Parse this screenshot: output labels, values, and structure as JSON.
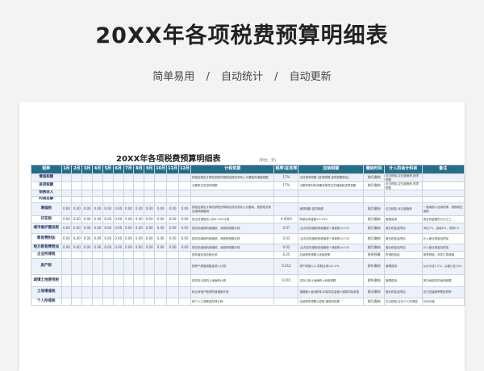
{
  "hero": {
    "title": "20XX年各项税费预算明细表",
    "tags": [
      "简单易用",
      "自动统计",
      "自动更新"
    ],
    "separator": "/"
  },
  "sheet": {
    "title": "20XX年各项税费预算明细表",
    "unit_note": "（单位：元）",
    "header_color": "#266d8a",
    "columns": [
      "税种",
      "1月",
      "2月",
      "3月",
      "4月",
      "5月",
      "6月",
      "7月",
      "8月",
      "9月",
      "10月",
      "11月",
      "12月",
      "计税依据",
      "税率\\征收率",
      "应纳税额",
      "缴纳时间",
      "计入的会计科目",
      "备注"
    ],
    "rows": [
      {
        "name": "增值税额",
        "months": [
          "",
          "",
          "",
          "",
          "",
          "",
          "",
          "",
          "",
          "",
          "",
          ""
        ],
        "basis": "按相应规定计算的销售货物和应税劳务收入为基础的增值税额",
        "rate": "17%",
        "tax": "当月销项税额-(进项税额-进项税额转出)",
        "time": "按月缴纳",
        "account": "应交税费-应交增值税-销项税额",
        "note": ""
      },
      {
        "name": "进项税额",
        "months": [
          "",
          "",
          "",
          "",
          "",
          "",
          "",
          "",
          "",
          "",
          "",
          ""
        ],
        "basis": "当期发生的进项税额",
        "rate": "17%",
        "tax": "当期采购材料或服务等发生的增值税进项税额",
        "time": "按月缴纳",
        "account": "应交税费-应交增值税-进项税额",
        "note": ""
      },
      {
        "name": "销售收入",
        "months": [
          "",
          "",
          "",
          "",
          "",
          "",
          "",
          "",
          "",
          "",
          "",
          ""
        ],
        "basis": "",
        "rate": "",
        "tax": "",
        "time": "",
        "account": "",
        "note": ""
      },
      {
        "name": "利润总额",
        "months": [
          "",
          "",
          "",
          "",
          "",
          "",
          "",
          "",
          "",
          "",
          "",
          ""
        ],
        "basis": "",
        "rate": "",
        "tax": "",
        "time": "",
        "account": "",
        "note": ""
      },
      {
        "name": "增值税",
        "months": [
          "0.00",
          "0.00",
          "0.00",
          "0.00",
          "0.00",
          "0.00",
          "0.00",
          "0.00",
          "0.00",
          "0.00",
          "0.00",
          "0.00"
        ],
        "basis": "按相应规定计算的销售货物和应税劳务收入为基础，按照相关规定缴纳增值税",
        "rate": "",
        "tax": "销项税额-进项税额",
        "time": "按月缴纳",
        "account": "应交税费-未交增值税",
        "note": "一般纳税人适用税率，按照规定缴纳"
      },
      {
        "name": "印花税",
        "months": [
          "0.00",
          "0.00",
          "0.00",
          "0.00",
          "0.00",
          "0.00",
          "0.00",
          "0.00",
          "0.00",
          "0.00",
          "0.00",
          "0.00"
        ],
        "basis": "按当月销售收入的0.03%计税",
        "rate": "0.0003",
        "tax": "购销合同金额×0.03%",
        "time": "按月缴纳",
        "account": "管理费用",
        "note": "按合同金额的万分之三"
      },
      {
        "name": "城市维护建设税",
        "months": [
          "0.00",
          "0.00",
          "0.00",
          "0.00",
          "0.00",
          "0.00",
          "0.00",
          "0.00",
          "0.00",
          "0.00",
          "0.00",
          "0.00"
        ],
        "basis": "按实际缴纳的增值税、消费税税额计税",
        "rate": "0.07",
        "tax": "(当月实际缴纳的增值税+消费税)×0.07",
        "time": "按月缴纳",
        "account": "营业税金及附加",
        "note": "市区7%，县城5%，其他1%"
      },
      {
        "name": "教育费附加",
        "months": [
          "0.00",
          "0.00",
          "0.00",
          "0.00",
          "0.00",
          "0.00",
          "0.00",
          "0.00",
          "0.00",
          "0.00",
          "0.00",
          "0.00"
        ],
        "basis": "按实际缴纳的增值税、消费税税额计税",
        "rate": "0.03",
        "tax": "(当月实际缴纳的增值税+消费税)×0.03",
        "time": "按月缴纳",
        "account": "营业税金及附加",
        "note": "计入营业税金及附加"
      },
      {
        "name": "地方教育费附加",
        "months": [
          "0.00",
          "0.00",
          "0.00",
          "0.00",
          "0.00",
          "0.00",
          "0.00",
          "0.00",
          "0.00",
          "0.00",
          "0.00",
          "0.00"
        ],
        "basis": "按实际缴纳的增值税、消费税税额计税",
        "rate": "0.02",
        "tax": "(当月实际缴纳的增值税+消费税)×0.02",
        "time": "按月缴纳",
        "account": "营业税金及附加",
        "note": "计入营业税金及附加"
      },
      {
        "name": "企业所得税",
        "months": [
          "",
          "",
          "",
          "",
          "",
          "",
          "",
          "",
          "",
          "",
          "",
          ""
        ],
        "basis": "按年度利润总额计税",
        "rate": "0.25",
        "tax": "应纳税所得额×适用税率",
        "time": "按季预缴",
        "account": "所得税费用",
        "note": "按季预缴，年终汇算清缴"
      },
      {
        "name": "房产税",
        "months": [
          "",
          "",
          "",
          "",
          "",
          "",
          "",
          "",
          "",
          "",
          "",
          ""
        ],
        "basis": "按房产原值或租金收入计税",
        "rate": "0.012",
        "tax": "房产原值×(1-扣除比例)×1.2%",
        "time": "按年缴纳",
        "account": "管理费用",
        "note": "从价计征1.2%，从租计征12%"
      },
      {
        "name": "城镇土地使用税",
        "months": [
          "",
          "",
          "",
          "",
          "",
          "",
          "",
          "",
          "",
          "",
          "",
          ""
        ],
        "basis": "按实际占用的土地面积计税",
        "rate": "0.015",
        "tax": "实际占用土地面积×适用税额",
        "time": "按年缴纳",
        "account": "管理费用",
        "note": "按当地规定的适用税额"
      },
      {
        "name": "土地增值税",
        "months": [
          "",
          "",
          "",
          "",
          "",
          "",
          "",
          "",
          "",
          "",
          "",
          ""
        ],
        "basis": "转让房地产取得的增值额计税",
        "rate": "",
        "tax": "增值额×适用税率-扣除项目金额×速算扣除系数",
        "time": "按次缴纳",
        "account": "营业税金及附加",
        "note": "实行四级超率累进税率"
      },
      {
        "name": "个人所得税",
        "months": [
          "",
          "",
          "",
          "",
          "",
          "",
          "",
          "",
          "",
          "",
          "",
          ""
        ],
        "basis": "按个人工资薪金所得计税",
        "rate": "",
        "tax": "应纳税所得额×税率-速算扣除数",
        "time": "按月缴纳",
        "account": "应交税费-应交个人所得税",
        "note": "代扣代缴"
      }
    ]
  }
}
